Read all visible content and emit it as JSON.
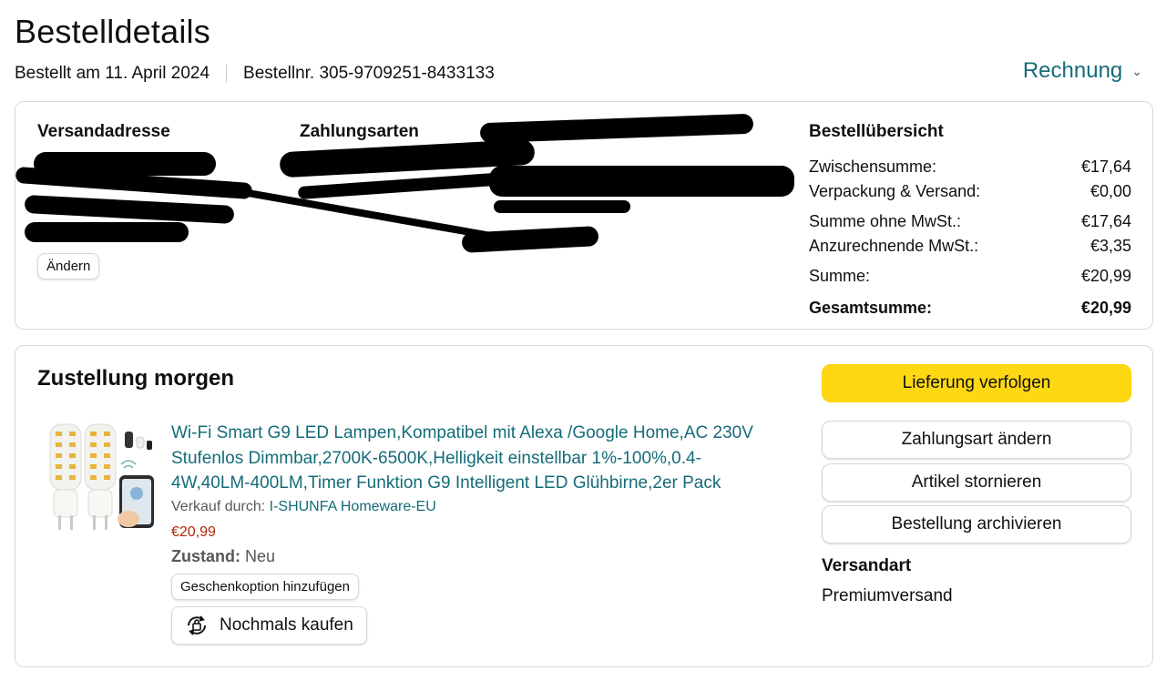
{
  "header": {
    "title": "Bestelldetails",
    "ordered_on": "Bestellt am 11. April 2024",
    "order_number": "Bestellnr. 305-9709251-8433133",
    "invoice_label": "Rechnung"
  },
  "overview": {
    "shipping_address_label": "Versandadresse",
    "payment_label": "Zahlungsarten",
    "change_label": "Ändern",
    "summary": {
      "title": "Bestellübersicht",
      "rows": [
        {
          "label": "Zwischensumme:",
          "value": "€17,64"
        },
        {
          "label": "Verpackung & Versand:",
          "value": "€0,00"
        },
        {
          "label": "Summe ohne MwSt.:",
          "value": "€17,64"
        },
        {
          "label": "Anzurechnende MwSt.:",
          "value": "€3,35"
        },
        {
          "label": "Summe:",
          "value": "€20,99"
        },
        {
          "label": "Gesamtsumme:",
          "value": "€20,99"
        }
      ]
    }
  },
  "delivery": {
    "title": "Zustellung morgen",
    "product": {
      "title": "Wi-Fi Smart G9 LED Lampen,Kompatibel mit Alexa /Google Home,AC 230V Stufenlos Dimmbar,2700K-6500K,Helligkeit einstellbar 1%-100%,0.4-4W,40LM-400LM,Timer Funktion G9 Intelligent LED Glühbirne,2er Pack",
      "seller_prefix": "Verkauf durch:",
      "seller_name": "I-SHUNFA Homeware-EU",
      "price": "€20,99",
      "condition_label": "Zustand:",
      "condition_value": "Neu",
      "gift_option_label": "Geschenkoption hinzufügen",
      "buy_again_label": "Nochmals kaufen"
    },
    "actions": {
      "track": "Lieferung verfolgen",
      "change_payment": "Zahlungsart ändern",
      "cancel_items": "Artikel stornieren",
      "archive": "Bestellung archivieren"
    },
    "shipping_method_label": "Versandart",
    "shipping_method_value": "Premiumversand"
  },
  "colors": {
    "link": "#146c78",
    "primary_button": "#ffd814",
    "price": "#b12704"
  }
}
